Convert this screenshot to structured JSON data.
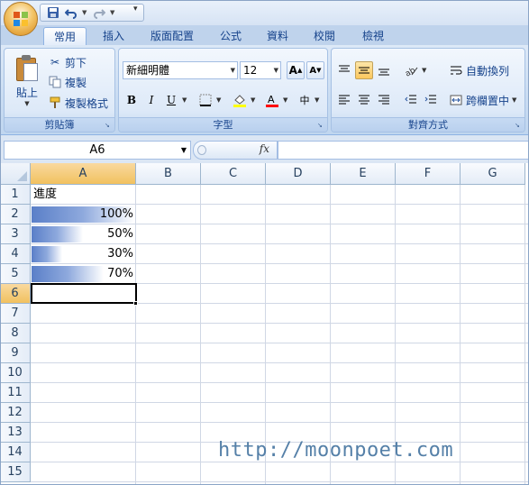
{
  "quick_access": {
    "save_icon": "save-icon",
    "undo_icon": "undo-icon",
    "redo_icon": "redo-icon",
    "more": "▾"
  },
  "tabs": [
    "常用",
    "插入",
    "版面配置",
    "公式",
    "資料",
    "校閱",
    "檢視"
  ],
  "active_tab": "常用",
  "ribbon": {
    "clipboard": {
      "paste_label": "貼上",
      "cut_label": "剪下",
      "copy_label": "複製",
      "format_painter_label": "複製格式",
      "group_label": "剪貼簿"
    },
    "font": {
      "font_name": "新細明體",
      "font_size": "12",
      "grow_label": "A",
      "shrink_label": "A",
      "bold": "B",
      "italic": "I",
      "underline": "U",
      "phonetic_label": "中",
      "group_label": "字型"
    },
    "alignment": {
      "wrap_text_label": "自動換列",
      "merge_label": "跨欄置中",
      "group_label": "對齊方式"
    }
  },
  "formula_bar": {
    "name_box": "A6",
    "fx_label": "fx",
    "formula": ""
  },
  "grid": {
    "columns": [
      "A",
      "B",
      "C",
      "D",
      "E",
      "F",
      "G"
    ],
    "rows": [
      "1",
      "2",
      "3",
      "4",
      "5",
      "6",
      "7",
      "8",
      "9",
      "10",
      "11",
      "12",
      "13",
      "14",
      "15"
    ],
    "selected_column": "A",
    "selected_row": "6",
    "a1": "進度",
    "progress": [
      {
        "label": "100%",
        "value": 1.0
      },
      {
        "label": "50%",
        "value": 0.5
      },
      {
        "label": "30%",
        "value": 0.3
      },
      {
        "label": "70%",
        "value": 0.7
      }
    ]
  },
  "watermark": "http://moonpoet.com",
  "colors": {
    "bar_start": "#5a7fc8",
    "selected_header": "#f1c15f",
    "ribbon_text": "#15428b"
  }
}
